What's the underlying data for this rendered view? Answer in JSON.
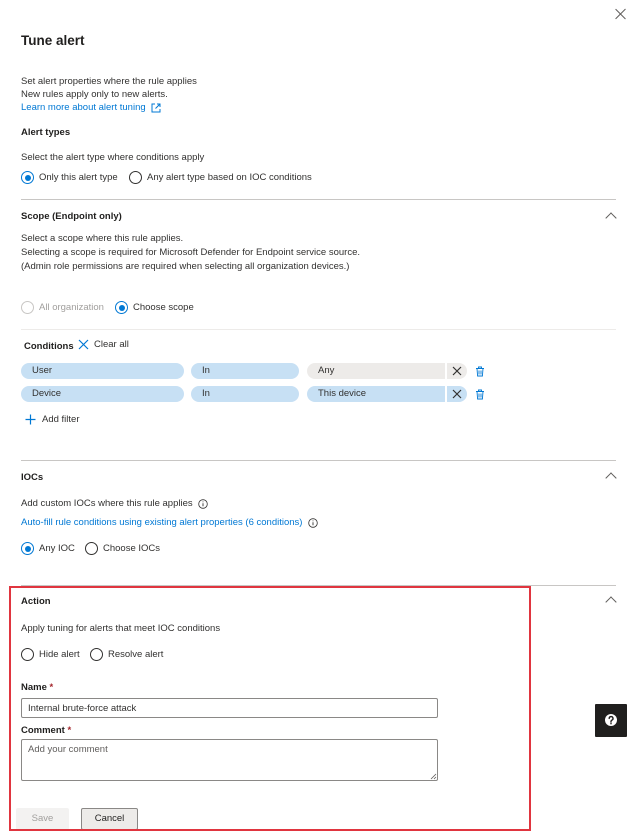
{
  "panel": {
    "title": "Tune alert",
    "intro_line1": "Set alert properties where the rule applies",
    "intro_line2": "New rules apply only to new alerts.",
    "learn_more": "Learn more about alert tuning"
  },
  "alert_types": {
    "heading": "Alert types",
    "prompt": "Select the alert type where conditions apply",
    "options": [
      "Only this alert type",
      "Any alert type based on IOC conditions"
    ],
    "selected": "Only this alert type"
  },
  "scope": {
    "heading": "Scope (Endpoint only)",
    "desc_line1": "Select a scope where this rule applies.",
    "desc_line2": "Selecting a scope is required for Microsoft Defender for Endpoint service source.",
    "desc_line3": "(Admin role permissions are required when selecting all organization devices.)",
    "options": [
      "All organization",
      "Choose scope"
    ],
    "selected": "Choose scope"
  },
  "conditions": {
    "label": "Conditions",
    "clear_all": "Clear all",
    "rows": [
      {
        "field": "User",
        "operator": "In",
        "value": "Any"
      },
      {
        "field": "Device",
        "operator": "In",
        "value": "This device"
      }
    ],
    "add_filter": "Add filter"
  },
  "iocs": {
    "heading": "IOCs",
    "desc": "Add custom IOCs where this rule applies",
    "autofill": "Auto-fill rule conditions using existing alert properties (6 conditions)",
    "options": [
      "Any IOC",
      "Choose IOCs"
    ],
    "selected": "Any IOC"
  },
  "action": {
    "heading": "Action",
    "desc": "Apply tuning for alerts that meet IOC conditions",
    "options": [
      "Hide alert",
      "Resolve alert"
    ],
    "name_label": "Name",
    "name_value": "Internal brute-force attack",
    "comment_label": "Comment",
    "comment_placeholder": "Add your comment",
    "required_mark": "*"
  },
  "buttons": {
    "save": "Save",
    "cancel": "Cancel"
  },
  "colors": {
    "accent": "#0078d4",
    "pill": "#c7e0f4",
    "highlight": "#e0353f"
  },
  "icons": [
    "close-icon",
    "external-link-icon",
    "chevron-up-icon",
    "clear-x-icon",
    "trash-icon",
    "plus-icon",
    "info-icon",
    "help-icon"
  ]
}
